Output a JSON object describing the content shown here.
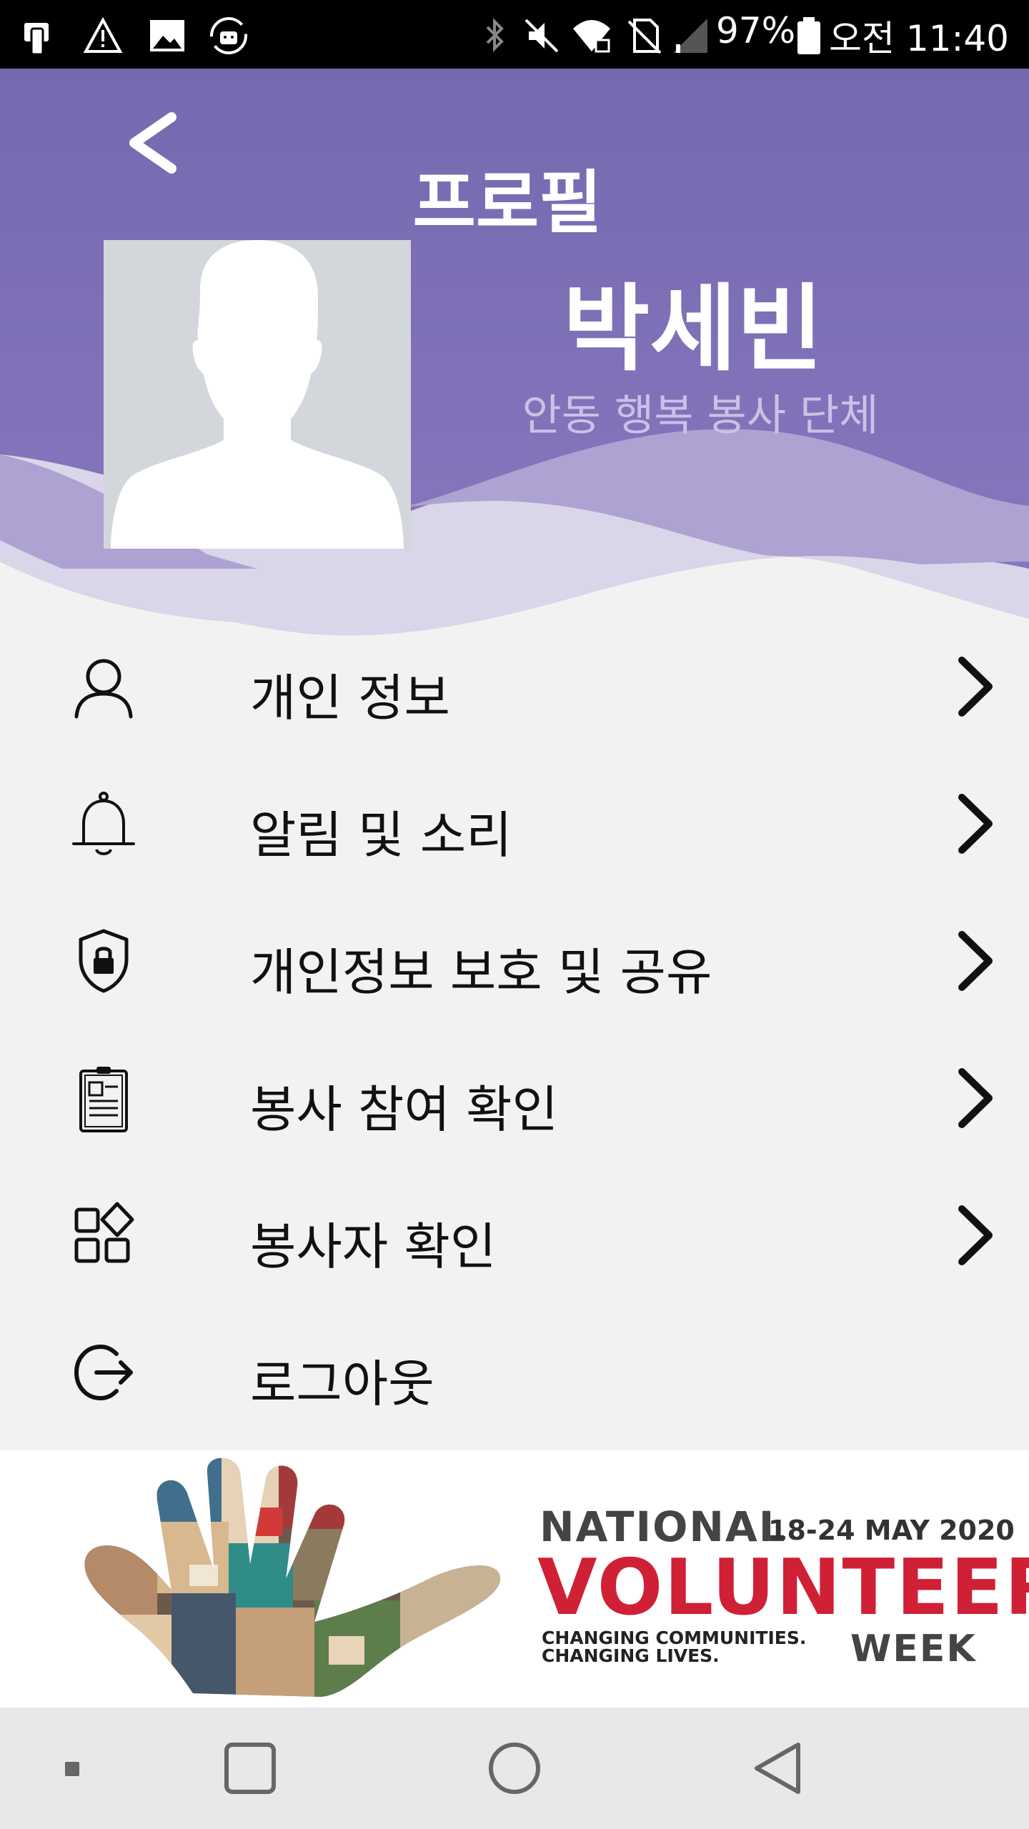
{
  "status_bar": {
    "battery": "97%",
    "time": "오전 11:40",
    "icons": [
      "sim-icon",
      "warning-icon",
      "gallery-icon",
      "android-sync-icon",
      "bluetooth-icon",
      "mute-icon",
      "wifi-lock-icon",
      "no-sim-icon",
      "signal-icon",
      "battery-icon"
    ]
  },
  "header": {
    "title": "프로필",
    "back_icon": "chevron-left-icon",
    "gradient_top": "#7d6cb4",
    "wave_light": "#ada2d2",
    "wave_lighter": "#d9d6ea"
  },
  "profile": {
    "name": "박세빈",
    "organization": "안동 행복 봉사 단체",
    "avatar_icon": "person-silhouette-icon"
  },
  "menu": {
    "items": [
      {
        "label": "개인 정보",
        "icon": "user-icon",
        "has_chevron": true
      },
      {
        "label": "알림 및 소리",
        "icon": "bell-icon",
        "has_chevron": true
      },
      {
        "label": "개인정보 보호 및 공유",
        "icon": "shield-lock-icon",
        "has_chevron": true
      },
      {
        "label": "봉사 참여 확인",
        "icon": "clipboard-icon",
        "has_chevron": true
      },
      {
        "label": "봉사자 확인",
        "icon": "grid-shapes-icon",
        "has_chevron": true
      },
      {
        "label": "로그아웃",
        "icon": "logout-icon",
        "has_chevron": false
      }
    ]
  },
  "banner": {
    "title": "NATIONAL",
    "dates": "18-24 MAY 2020",
    "headline": "VOLUNTEER",
    "tagline_1": "CHANGING COMMUNITIES.",
    "tagline_2": "CHANGING LIVES.",
    "week": "WEEK",
    "accent": "#d02035",
    "image": "hand-collage-image"
  },
  "nav_bar": {
    "buttons": [
      "menu-dot-icon",
      "recent-apps-icon",
      "home-icon",
      "back-triangle-icon"
    ]
  }
}
